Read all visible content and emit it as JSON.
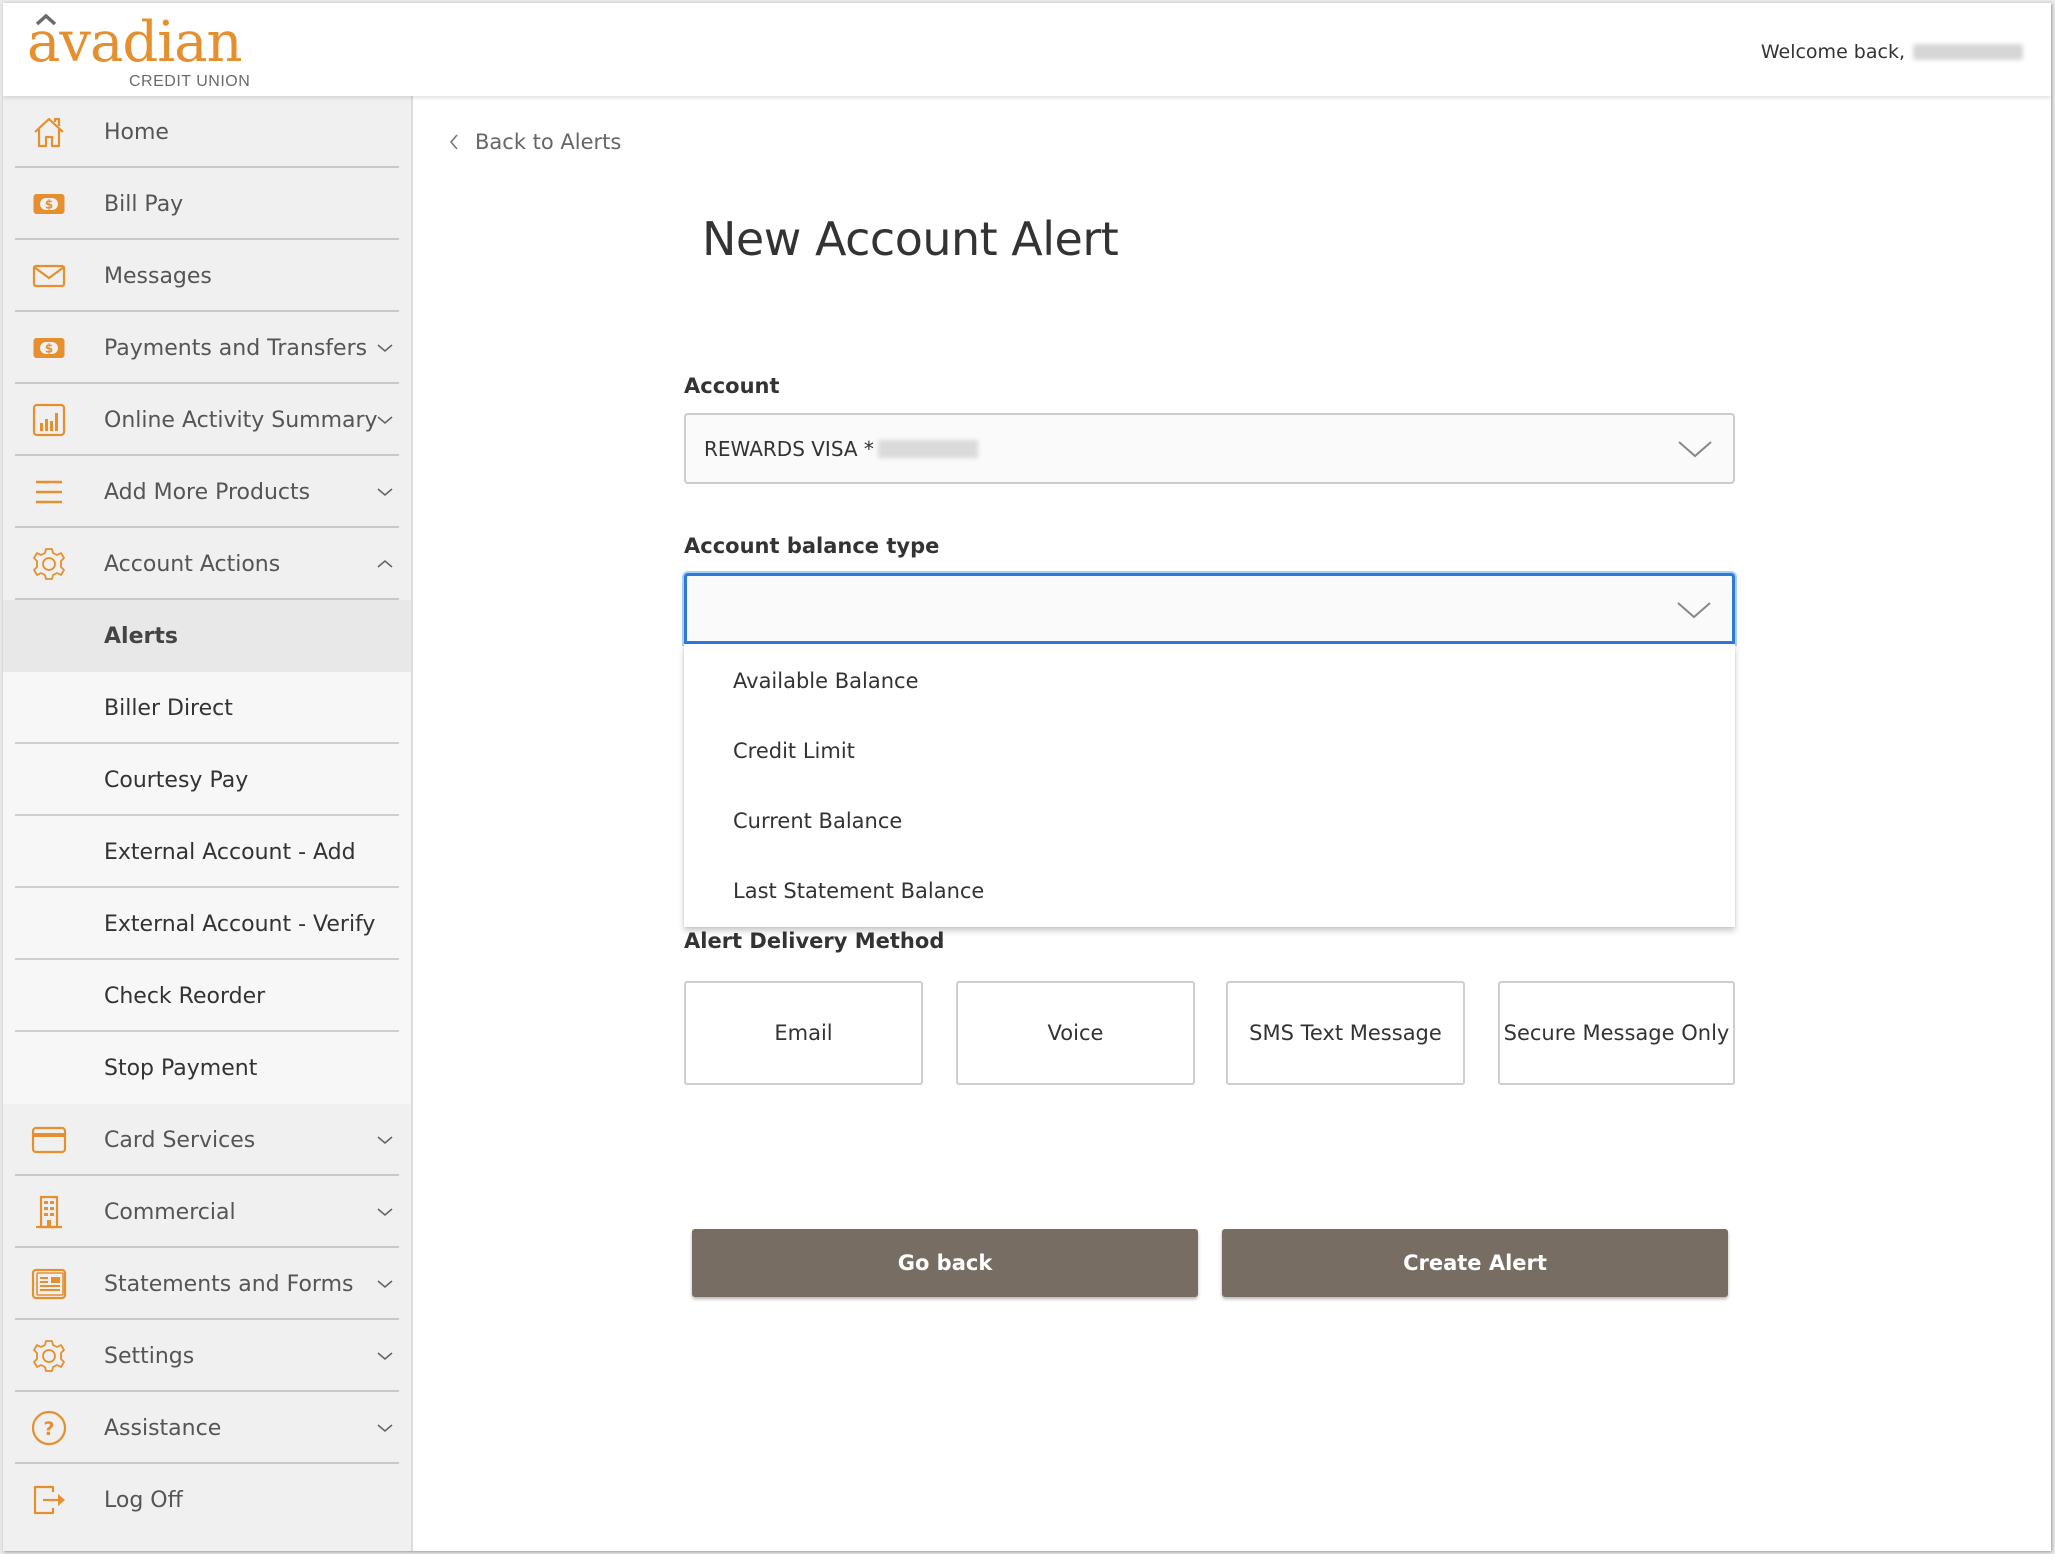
{
  "header": {
    "logo_text": "avadian",
    "logo_subtext": "CREDIT UNION",
    "welcome_text": "Welcome back,",
    "brand_color": "#e58f2f"
  },
  "sidebar": {
    "items_top": [
      {
        "label": "Home",
        "icon": "home-icon",
        "has_chevron": false
      },
      {
        "label": "Bill Pay",
        "icon": "dollar-bill-icon",
        "has_chevron": false
      },
      {
        "label": "Messages",
        "icon": "envelope-icon",
        "has_chevron": false
      },
      {
        "label": "Payments and Transfers",
        "icon": "dollar-bill-icon",
        "has_chevron": true
      },
      {
        "label": "Online Activity Summary",
        "icon": "bar-chart-icon",
        "has_chevron": true
      },
      {
        "label": "Add More Products",
        "icon": "menu-lines-icon",
        "has_chevron": true
      },
      {
        "label": "Account Actions",
        "icon": "gear-icon",
        "has_chevron": true,
        "expanded": true
      }
    ],
    "sub_items": [
      {
        "label": "Alerts",
        "active": true
      },
      {
        "label": "Biller Direct"
      },
      {
        "label": "Courtesy Pay"
      },
      {
        "label": "External Account - Add"
      },
      {
        "label": "External Account - Verify"
      },
      {
        "label": "Check Reorder"
      },
      {
        "label": "Stop Payment"
      }
    ],
    "items_bottom": [
      {
        "label": "Card Services",
        "icon": "credit-card-icon",
        "has_chevron": true
      },
      {
        "label": "Commercial",
        "icon": "building-icon",
        "has_chevron": true
      },
      {
        "label": "Statements and Forms",
        "icon": "newspaper-icon",
        "has_chevron": true
      },
      {
        "label": "Settings",
        "icon": "gear-icon",
        "has_chevron": true
      },
      {
        "label": "Assistance",
        "icon": "question-circle-icon",
        "has_chevron": true
      },
      {
        "label": "Log Off",
        "icon": "logout-icon",
        "has_chevron": false
      }
    ]
  },
  "main": {
    "back_link": "Back to Alerts",
    "title": "New Account Alert",
    "account_label": "Account",
    "account_value": "REWARDS VISA *",
    "balance_type_label": "Account balance type",
    "balance_type_value": "",
    "balance_type_options": [
      "Available Balance",
      "Credit Limit",
      "Current Balance",
      "Last Statement Balance"
    ],
    "delivery_label": "Alert Delivery Method",
    "delivery_options": [
      "Email",
      "Voice",
      "SMS Text Message",
      "Secure Message Only"
    ],
    "go_back_label": "Go back",
    "create_label": "Create Alert",
    "button_color": "#776d63",
    "focus_color": "#2f7ad6"
  }
}
